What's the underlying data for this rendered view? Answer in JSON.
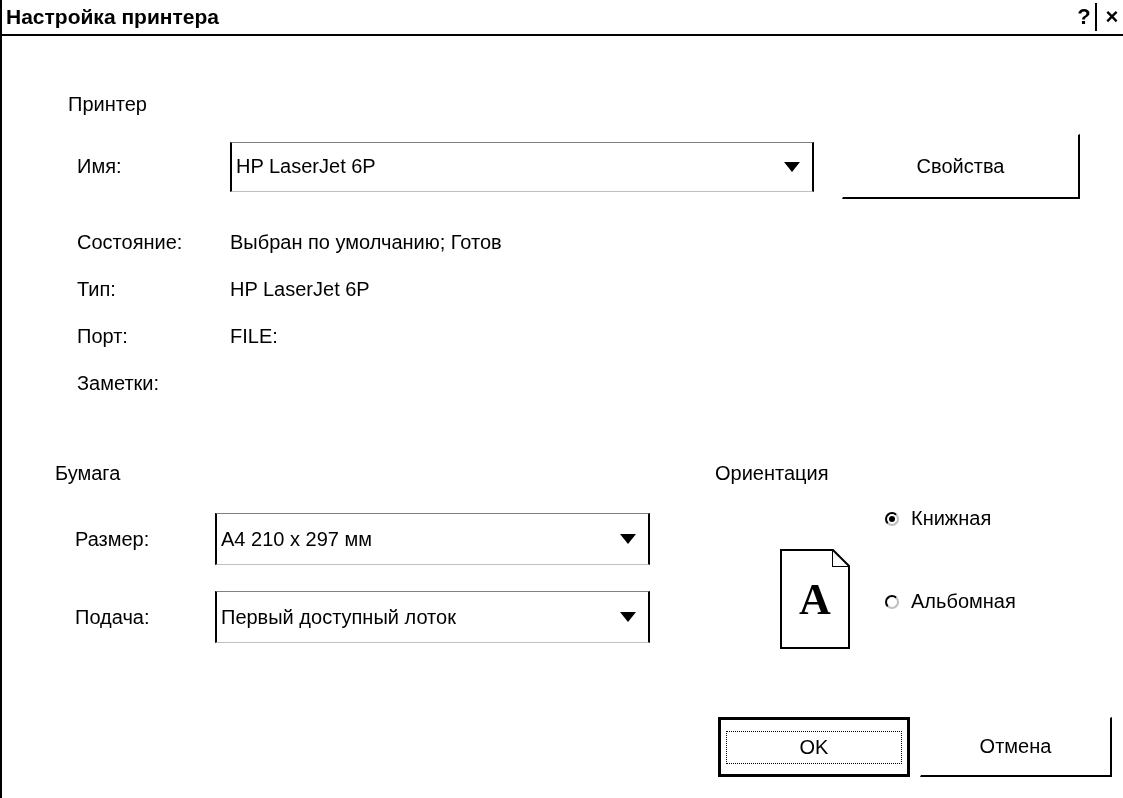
{
  "window": {
    "title": "Настройка принтера",
    "buttons": [
      "?",
      "×"
    ]
  },
  "printer": {
    "heading": "Принтер",
    "name_label": "Имя:",
    "name_value": "HP LaserJet 6P",
    "properties_button": "Свойства",
    "info": [
      {
        "label": "Состояние:",
        "value": "Выбран по умолчанию; Готов"
      },
      {
        "label": "Тип:",
        "value": "HP LaserJet 6P"
      },
      {
        "label": "Порт:",
        "value": "FILE:"
      },
      {
        "label": "Заметки:"
      }
    ]
  },
  "paper": {
    "heading": "Бумага",
    "fields": [
      {
        "label": "Размер:",
        "value": "A4 210 x 297 мм"
      },
      {
        "label": "Подача:",
        "value": "Первый доступный лоток"
      }
    ]
  },
  "orientation": {
    "heading": "Ориентация",
    "preview": "A",
    "options": [
      {
        "label": "Книжная",
        "selected": true
      },
      {
        "label": "Альбомная",
        "selected": false
      }
    ]
  },
  "buttons": [
    {
      "label": "OK",
      "default": true
    },
    {
      "label": "Отмена",
      "default": false
    }
  ]
}
